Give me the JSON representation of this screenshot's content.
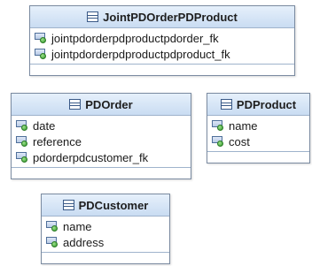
{
  "classes": {
    "joint": {
      "title": "JointPDOrderPDProduct",
      "attributes": [
        "jointpdorderpdproductpdorder_fk",
        "jointpdorderpdproductpdproduct_fk"
      ]
    },
    "order": {
      "title": "PDOrder",
      "attributes": [
        "date",
        "reference",
        "pdorderpdcustomer_fk"
      ]
    },
    "product": {
      "title": "PDProduct",
      "attributes": [
        "name",
        "cost"
      ]
    },
    "customer": {
      "title": "PDCustomer",
      "attributes": [
        "name",
        "address"
      ]
    }
  },
  "icons": {
    "class": "class-icon",
    "attribute": "attribute-icon"
  },
  "colors": {
    "header_top": "#e6f0fb",
    "header_bottom": "#c9dcf2",
    "border": "#7a8aa0",
    "attribute_dot": "#2f9a2a"
  }
}
